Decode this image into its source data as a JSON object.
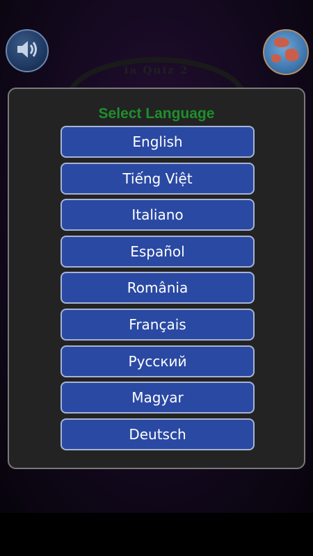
{
  "header": {
    "sound_icon": "speaker-icon",
    "globe_icon": "globe-icon",
    "logo_text": "ia Quiz 2"
  },
  "dialog": {
    "title": "Select Language",
    "languages": [
      {
        "label": "English"
      },
      {
        "label": "Tiếng Việt"
      },
      {
        "label": "Italiano"
      },
      {
        "label": "Español"
      },
      {
        "label": "România"
      },
      {
        "label": "Français"
      },
      {
        "label": "Русский"
      },
      {
        "label": "Magyar"
      },
      {
        "label": "Deutsch"
      }
    ]
  },
  "colors": {
    "title": "#1e8f2b",
    "button": "#2a49a3",
    "dialog_bg": "#232323"
  }
}
